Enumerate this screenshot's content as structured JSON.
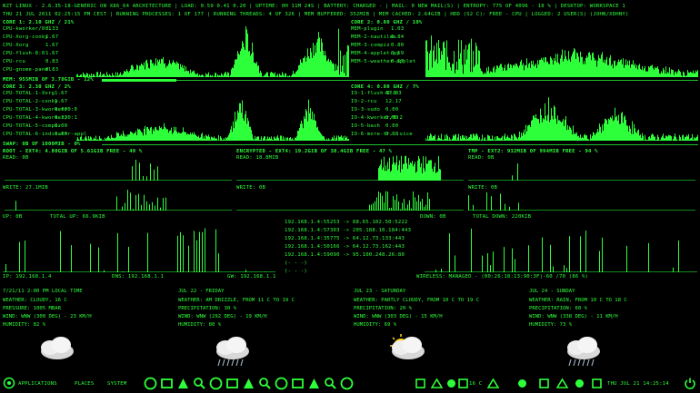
{
  "top": {
    "line1": "NZT LINUX - 2.6.35-18-GENERIC ON X86_64 ARCHITECTURE | LOAD: 0.59 0.41 0.20 | UPTIME: 0H 11M 24S | BATTERY: CHARGED - | MAIL: 0 NEW MAIL(S) | ENTROPY: 775 OF 4096 - 18 % | DESKTOP: WORKSPACE 1",
    "line2": "THU 21 JUL 2011 02:25:15 PM CEST | RUNNING PROCESSES: 1 OF 177 | RUNNING THREADS: 4 OF 326 | MEM BUFFERED: 352MIB | MEM CACHED: 2.64GIB | HDD (S2 C): FREE - CPU | LOGGED: 2 USER(S) (JOHN/XDHNY)"
  },
  "core1": {
    "title": "CORE 1: 2.10 GHZ / 21%",
    "procs": [
      [
        "CPU-kworker/0:1",
        "0.33"
      ],
      [
        "CPU-Xorg-conky",
        "1.67"
      ],
      [
        "CPU-Xorg",
        "1.67"
      ],
      [
        "CPU-flush-8:0",
        "1.67"
      ],
      [
        "CPU-rcu",
        "0.83"
      ],
      [
        "CPU-gnome-panel",
        "0.83"
      ]
    ]
  },
  "core2": {
    "title": "CORE 2: 0.80 GHZ / 10%",
    "procs": [
      [
        "MEM-plugin",
        "1.03"
      ],
      [
        "MEM-2-nautilus",
        "0.84"
      ],
      [
        "MEM-3-compiz",
        "0.80"
      ],
      [
        "MEM-4-applet.py",
        "0.59"
      ],
      [
        "MEM-5-weather-applet",
        "0.57"
      ]
    ]
  },
  "mem": {
    "title": "MEM: 955MIB OF 3.78GIB - 12%"
  },
  "core3": {
    "title": "CORE 3: 2.30 GHZ / 2%",
    "procs": [
      [
        "CPU-TOTAL-1-Xorg",
        "1.67"
      ],
      [
        "CPU-TOTAL-2-conky",
        "1.67"
      ],
      [
        "CPU-TOTAL-3-kworker/0:0",
        "0.00"
      ],
      [
        "CPU-TOTAL-4-kworker/0:1",
        "0.33"
      ],
      [
        "CPU-TOTAL-5-compiz",
        "0.00"
      ],
      [
        "CPU-TOTAL-6-indicator-appl",
        "0.00"
      ]
    ]
  },
  "core4": {
    "title": "CORE 4: 0.80 GHZ / 7%",
    "procs": [
      [
        "IO-1-flush-8:0",
        "67.83"
      ],
      [
        "IO-2-rcu",
        "12.17"
      ],
      [
        "IO-3-sudo",
        "0.00"
      ],
      [
        "IO-4-kworker/0:2",
        "0.00"
      ],
      [
        "IO-5-bash",
        "0.00"
      ],
      [
        "IO-6-more-tr...vice",
        "0.00"
      ]
    ]
  },
  "swap": {
    "title": "SWAP: 0B OF 1000MIB - 0%"
  },
  "disks": [
    {
      "title": "ROOT - EXT4: 4.80GIB OF 5.61GIB FREE - 49 %",
      "read": "READ: 0B",
      "write": "WRITE: 27.1MIB"
    },
    {
      "title": "ENCRYPTED - EXT4: 19.2GIB OF 38.4GIB FREE - 47 %",
      "read": "READ: 18.8MIB",
      "write": "WRITE: 0B"
    },
    {
      "title": "TMP - EXT2: 932MIB OF 994MIB FREE - 94 %",
      "read": "READ: 0B",
      "write": "WRITE: 0B"
    }
  ],
  "net": {
    "up": "UP: 0B",
    "total_up": "TOTAL UP: 66.9KIB",
    "down": "DOWN: 0B",
    "total_down": "TOTAL DOWN: 220KIB",
    "connections": [
      "192.168.1.4:55253 -> 88.65.102.50:5222",
      "192.168.1.4:57303 -> 205.188.10.184:443",
      "192.168.1.4:35775 -> 64.12.73.133:443",
      "192.168.1.4:50166 -> 64.12.73.162:443",
      "192.168.1.4:59090 -> 95.100.248.26:80",
      "(- - -)",
      "(- - -)"
    ],
    "ip": "IP: 192.168.1.4",
    "dns": "DNS: 192.168.1.1",
    "gw": "GW: 192.168.1.1",
    "wireless": "WIRELESS: MANAGED - (00:26:18:13:90:3F)-60 /70 (86 %)"
  },
  "weather": [
    {
      "date": "7/21/11 2:00 PM LOCAL TIME",
      "cond": "WEATHER: CLOUDY, 16 C",
      "l2": "PRESSURE: 1005 MBAR",
      "l3": "WIND: WNW (300 DEG) - 23 KM/H",
      "l4": "HUMIDITY: 82 %"
    },
    {
      "date": "JUL 22 - FRIDAY",
      "cond": "WEATHER: AM DRIZZLE, FROM 11 C TO 19 C",
      "l2": "PRECIPITATION: 30 %",
      "l3": "WIND: WNW (292 DEG) - 19 KM/H",
      "l4": "HUMIDITY: 80 %"
    },
    {
      "date": "JUL 23 - SATURDAY",
      "cond": "WEATHER: PARTLY CLOUDY, FROM 10 C TO 19 C",
      "l2": "PRECIPITATION: 20 %",
      "l3": "WIND: WNW (303 DEG) - 15 KM/H",
      "l4": "HUMIDITY: 69 %"
    },
    {
      "date": "JUL 24 - SUNDAY",
      "cond": "WEATHER: RAIN, FROM 10 C TO 18 C",
      "l2": "PRECIPITATION: 60 %",
      "l3": "WIND: WNW (338 DEG) - 11 KM/H",
      "l4": "HUMIDITY: 73 %"
    }
  ],
  "taskbar": {
    "applications": "APPLICATIONS",
    "places": "PLACES",
    "system": "SYSTEM",
    "temp": "16 C",
    "clock": "THU JUL 21  14:25:14"
  },
  "colors": {
    "accent": "#2dff3a",
    "dim": "#128a1c",
    "bg": "#000000"
  }
}
